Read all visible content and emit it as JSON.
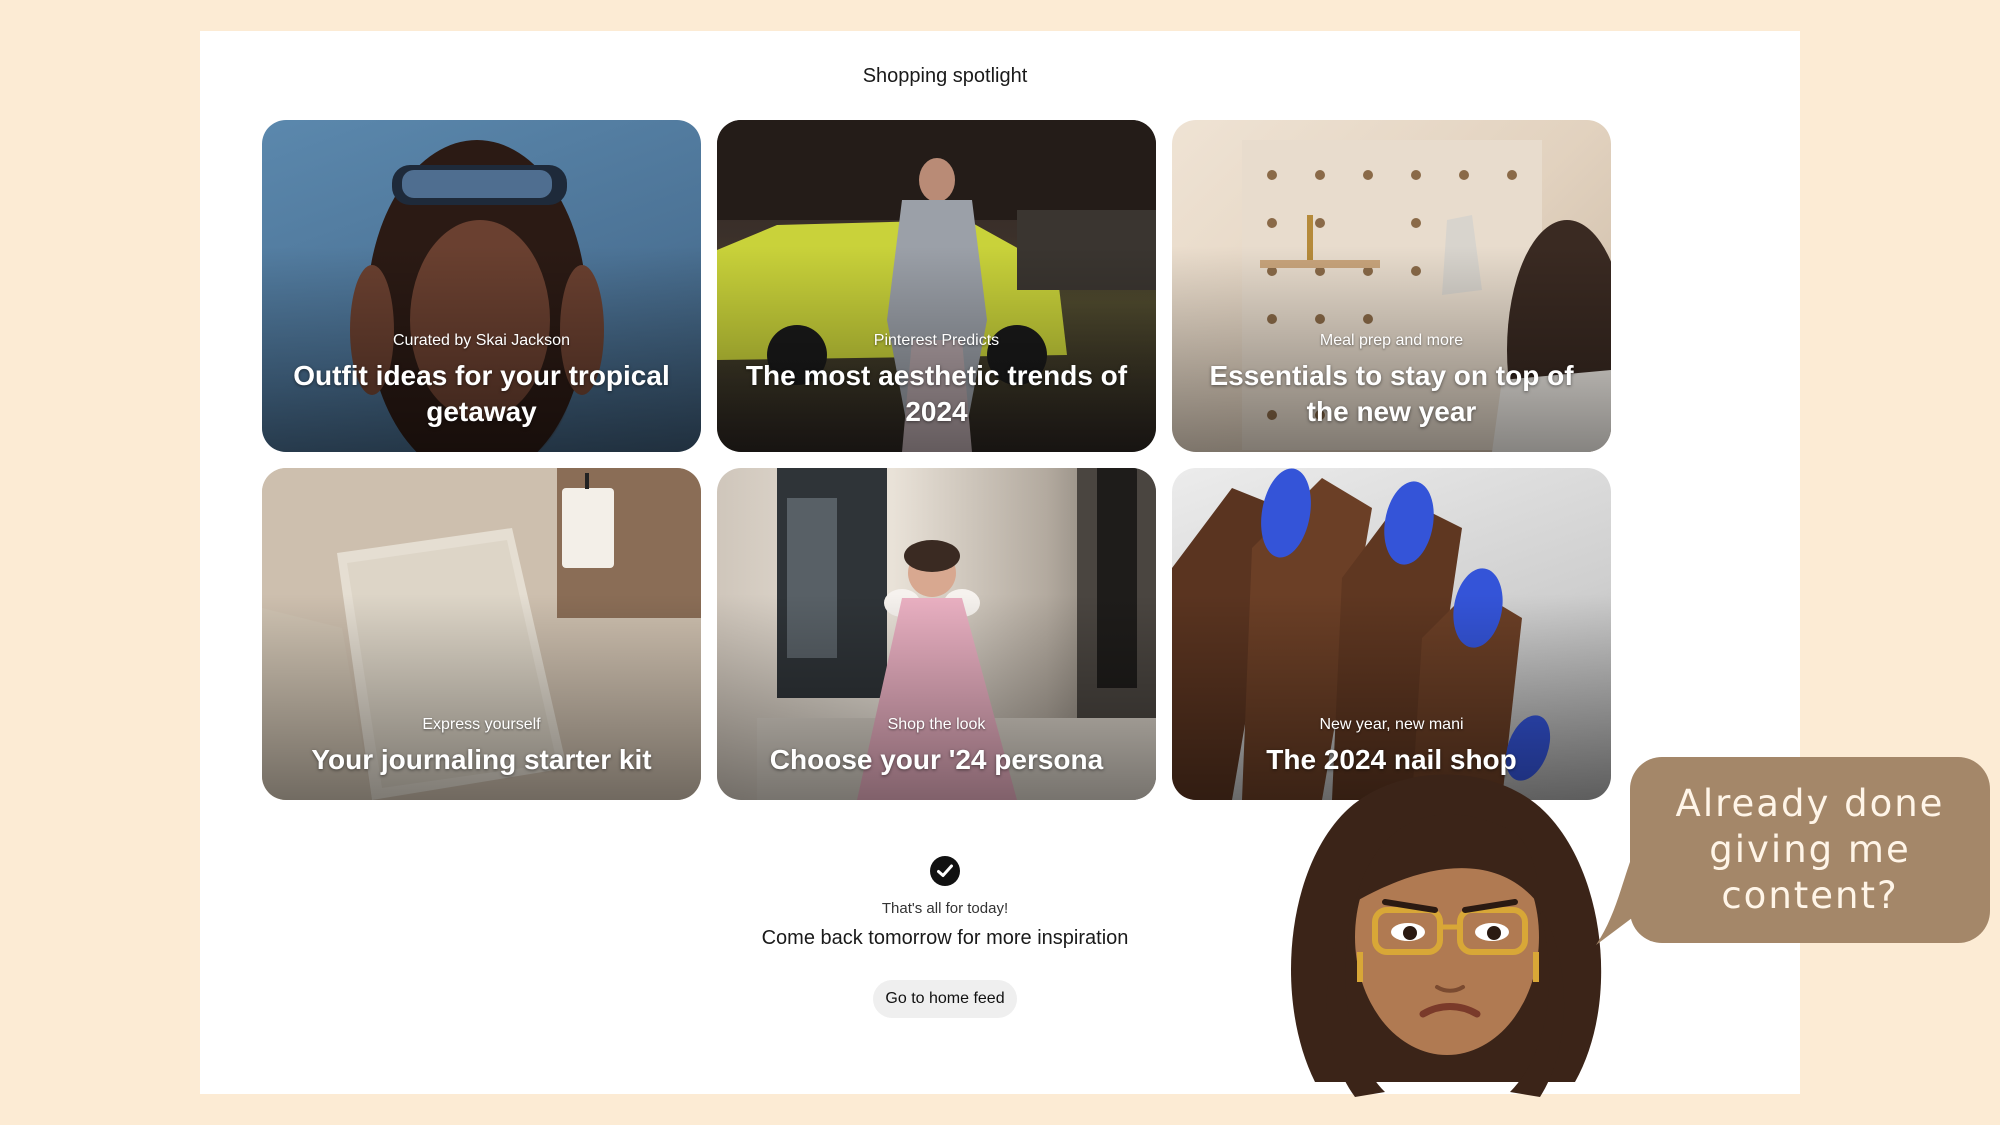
{
  "page_title": "Shopping spotlight",
  "cards": [
    {
      "sub": "Curated by Skai Jackson",
      "head": "Outfit ideas for your tropical getaway"
    },
    {
      "sub": "Pinterest Predicts",
      "head": "The most aesthetic trends of 2024"
    },
    {
      "sub": "Meal prep and more",
      "head": "Essentials to stay on top of the new year"
    },
    {
      "sub": "Express yourself",
      "head": "Your journaling starter kit"
    },
    {
      "sub": "Shop the look",
      "head": "Choose your '24 persona"
    },
    {
      "sub": "New year, new mani",
      "head": "The 2024 nail shop"
    }
  ],
  "footer": {
    "done_text": "That's all for today!",
    "done_sub": "Come back tomorrow for more inspiration",
    "button_label": "Go to home feed"
  },
  "bubble": {
    "text": "Already done giving me content?"
  },
  "icons": {
    "check": "checkmark-circle-icon",
    "avatar": "bitmoji-avatar"
  },
  "colors": {
    "page_bg": "#fcebd4",
    "bubble_bg": "#a48769",
    "check_bg": "#111111"
  }
}
